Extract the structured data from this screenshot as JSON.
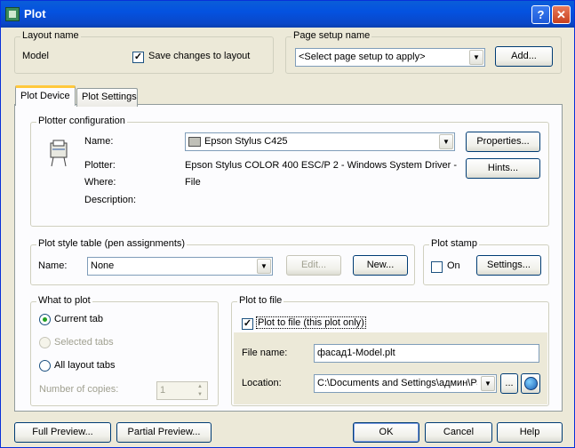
{
  "window": {
    "title": "Plot"
  },
  "layout_name": {
    "legend": "Layout name",
    "value": "Model",
    "save_changes_checked": true,
    "save_changes_label": "Save changes to layout"
  },
  "page_setup": {
    "legend": "Page setup name",
    "selected": "<Select page setup to apply>",
    "add_label": "Add..."
  },
  "tabs": [
    "Plot Device",
    "Plot Settings"
  ],
  "plotter_config": {
    "legend": "Plotter configuration",
    "name_label": "Name:",
    "name_value": "Epson Stylus C425",
    "properties_label": "Properties...",
    "hints_label": "Hints...",
    "plotter_label": "Plotter:",
    "plotter_value": "Epson Stylus COLOR 400 ESC/P 2 - Windows System Driver -",
    "where_label": "Where:",
    "where_value": "File",
    "description_label": "Description:"
  },
  "plot_style": {
    "legend": "Plot style table (pen assignments)",
    "name_label": "Name:",
    "name_value": "None",
    "edit_label": "Edit...",
    "new_label": "New..."
  },
  "plot_stamp": {
    "legend": "Plot stamp",
    "on_label": "On",
    "on_checked": false,
    "settings_label": "Settings..."
  },
  "what_to_plot": {
    "legend": "What to plot",
    "options": [
      "Current tab",
      "Selected tabs",
      "All layout tabs"
    ],
    "copies_label": "Number of copies:",
    "copies_value": "1"
  },
  "plot_to_file": {
    "legend": "Plot to file",
    "checkbox_label": "Plot to file (this plot only)",
    "checked": true,
    "file_name_label": "File name:",
    "file_name_value": "фасад1-Model.plt",
    "location_label": "Location:",
    "location_value": "C:\\Documents and Settings\\админ\\Ра",
    "browse_label": "..."
  },
  "footer": {
    "full_preview": "Full Preview...",
    "partial_preview": "Partial Preview...",
    "ok": "OK",
    "cancel": "Cancel",
    "help": "Help"
  }
}
